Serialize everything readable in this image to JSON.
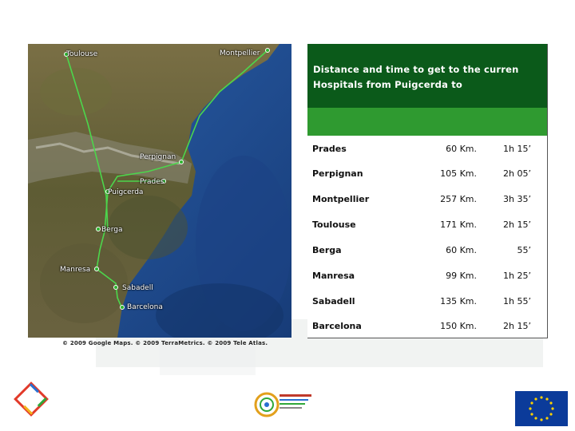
{
  "map": {
    "labels": {
      "toulouse": "Toulouse",
      "montpellier": "Montpellier",
      "perpignan": "Perpignan",
      "prades": "Prades",
      "puigcerda": "Puigcerda",
      "berga": "Berga",
      "manresa": "Manresa",
      "sabadell": "Sabadell",
      "barcelona": "Barcelona"
    },
    "copyright": "© 2009 Google Maps. © 2009 TerraMetrics. © 2009 Tele Atlas."
  },
  "table": {
    "title_line1": "Distance and time to get to the curren",
    "title_line2": "Hospitals from Puigcerda to",
    "rows": [
      {
        "city": "Prades",
        "distance": "60 Km.",
        "time": "1h 15’"
      },
      {
        "city": "Perpignan",
        "distance": "105 Km.",
        "time": "2h 05’"
      },
      {
        "city": "Montpellier",
        "distance": "257 Km.",
        "time": "3h 35’"
      },
      {
        "city": "Toulouse",
        "distance": "171 Km.",
        "time": "2h 15’"
      },
      {
        "city": "Berga",
        "distance": "60 Km.",
        "time": "55’"
      },
      {
        "city": "Manresa",
        "distance": "99 Km.",
        "time": "1h 25’"
      },
      {
        "city": "Sabadell",
        "distance": "135 Km.",
        "time": "1h 55’"
      },
      {
        "city": "Barcelona",
        "distance": "150 Km.",
        "time": "2h 15’"
      }
    ],
    "colors": {
      "header": "#0b5a1a",
      "subheader": "#2f9a30"
    }
  },
  "colors": {
    "route": "#4cd64c",
    "sea": "#1d4a8c",
    "land": "#6b6a3e"
  }
}
